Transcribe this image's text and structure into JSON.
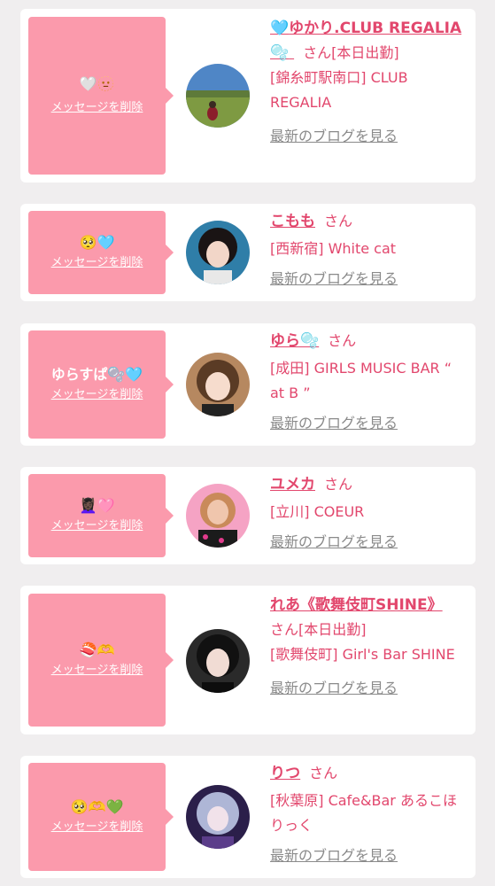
{
  "delete_label": "メッセージを削除",
  "blog_label": "最新のブログを見る",
  "san_label": "さん",
  "colors": {
    "background": "#f0eeef",
    "bubble": "#fb9aac",
    "accent": "#e2476d",
    "link_gray": "#8a8a8a"
  },
  "items": [
    {
      "message_icons": [
        "white-heart-icon",
        "dotted-face-icon"
      ],
      "message_text": "🤍🫥",
      "name_icon": "light-blue-heart-icon",
      "name": "ゆかり.CLUB REGALIA",
      "name_prefix": "🩵",
      "name_suffix_icon": "bubbles-icon",
      "name_suffix": "🫧",
      "badge": "[本日出勤]",
      "shop": "[錦糸町駅南口] CLUB REGALIA"
    },
    {
      "message_icons": [
        "pleading-face-icon",
        "light-blue-heart-icon"
      ],
      "message_text": "🥺🩵",
      "name": "こもも",
      "name_prefix": "",
      "name_suffix": "",
      "badge": "",
      "shop": "[西新宿] White cat"
    },
    {
      "message_icons": [
        "bubbles-icon",
        "light-blue-heart-icon"
      ],
      "message_text": "ゆらすぱ🫧🩵",
      "name": "ゆら",
      "name_prefix": "",
      "name_suffix_icon": "bubbles-icon",
      "name_suffix": "🫧",
      "badge": "",
      "shop": "[成田] GIRLS MUSIC BAR “ at B ”"
    },
    {
      "message_icons": [
        "dancer-icon",
        "pink-heart-icon"
      ],
      "message_text": "💆🏿‍♀️🩷",
      "name": "ユメカ",
      "name_prefix": "",
      "name_suffix": "",
      "badge": "",
      "shop": "[立川] COEUR"
    },
    {
      "message_icons": [
        "sushi-icon",
        "heart-hands-icon"
      ],
      "message_text": "🍣🫶",
      "name": "れあ《歌舞伎町SHINE》",
      "name_prefix": "",
      "name_suffix": "",
      "badge": "[本日出勤]",
      "shop": "[歌舞伎町] Girl's Bar SHINE"
    },
    {
      "message_icons": [
        "pleading-face-icon",
        "heart-hands-icon",
        "green-heart-icon"
      ],
      "message_text": "🥺🫶💚",
      "name": "りつ",
      "name_prefix": "",
      "name_suffix": "",
      "badge": "",
      "shop": "[秋葉原] Cafe&Bar あるこほりっく"
    }
  ]
}
